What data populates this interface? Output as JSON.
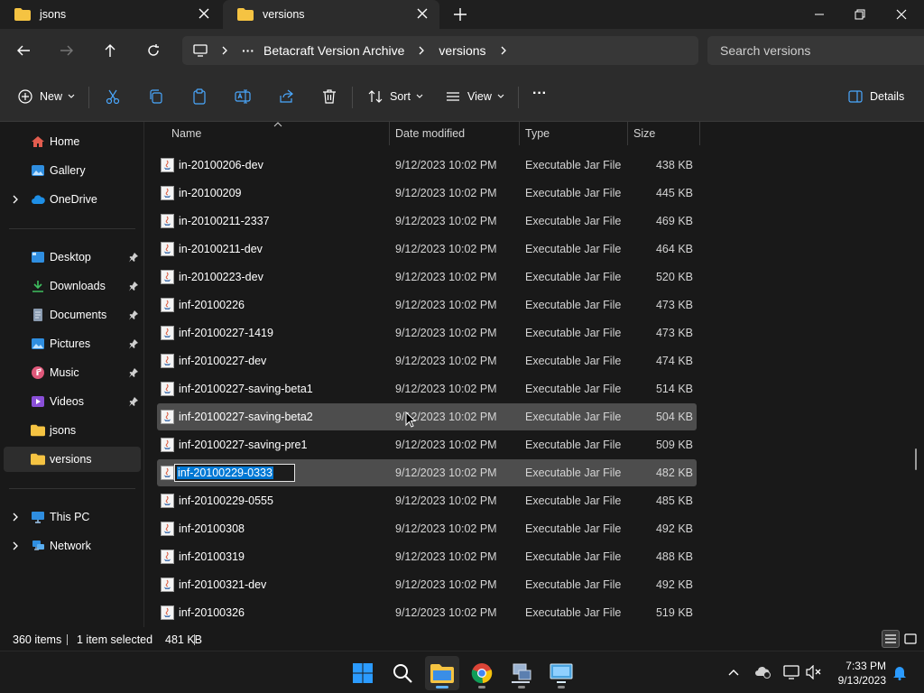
{
  "tabs": [
    {
      "label": "jsons",
      "active": false
    },
    {
      "label": "versions",
      "active": true
    }
  ],
  "breadcrumb": {
    "ellipsis": "···",
    "items": [
      "Betacraft Version Archive",
      "versions"
    ]
  },
  "search": {
    "placeholder": "Search versions"
  },
  "toolbar": {
    "new_label": "New",
    "sort_label": "Sort",
    "view_label": "View",
    "more_label": "···",
    "details_label": "Details"
  },
  "sidebar": {
    "top": [
      {
        "label": "Home",
        "icon": "home-icon"
      },
      {
        "label": "Gallery",
        "icon": "gallery-icon"
      },
      {
        "label": "OneDrive",
        "icon": "cloud-icon"
      }
    ],
    "pinned": [
      {
        "label": "Desktop",
        "icon": "desktop-icon"
      },
      {
        "label": "Downloads",
        "icon": "download-icon"
      },
      {
        "label": "Documents",
        "icon": "document-icon"
      },
      {
        "label": "Pictures",
        "icon": "pictures-icon"
      },
      {
        "label": "Music",
        "icon": "music-icon"
      },
      {
        "label": "Videos",
        "icon": "videos-icon"
      },
      {
        "label": "jsons",
        "icon": "folder-icon"
      },
      {
        "label": "versions",
        "icon": "folder-icon"
      }
    ],
    "bottom": [
      {
        "label": "This PC",
        "icon": "pc-icon"
      },
      {
        "label": "Network",
        "icon": "network-icon"
      }
    ]
  },
  "columns": {
    "name": "Name",
    "date": "Date modified",
    "type": "Type",
    "size": "Size"
  },
  "files": [
    {
      "name": "in-20100206-dev",
      "date": "9/12/2023 10:02 PM",
      "type": "Executable Jar File",
      "size": "438 KB"
    },
    {
      "name": "in-20100209",
      "date": "9/12/2023 10:02 PM",
      "type": "Executable Jar File",
      "size": "445 KB"
    },
    {
      "name": "in-20100211-2337",
      "date": "9/12/2023 10:02 PM",
      "type": "Executable Jar File",
      "size": "469 KB"
    },
    {
      "name": "in-20100211-dev",
      "date": "9/12/2023 10:02 PM",
      "type": "Executable Jar File",
      "size": "464 KB"
    },
    {
      "name": "in-20100223-dev",
      "date": "9/12/2023 10:02 PM",
      "type": "Executable Jar File",
      "size": "520 KB"
    },
    {
      "name": "inf-20100226",
      "date": "9/12/2023 10:02 PM",
      "type": "Executable Jar File",
      "size": "473 KB"
    },
    {
      "name": "inf-20100227-1419",
      "date": "9/12/2023 10:02 PM",
      "type": "Executable Jar File",
      "size": "473 KB"
    },
    {
      "name": "inf-20100227-dev",
      "date": "9/12/2023 10:02 PM",
      "type": "Executable Jar File",
      "size": "474 KB"
    },
    {
      "name": "inf-20100227-saving-beta1",
      "date": "9/12/2023 10:02 PM",
      "type": "Executable Jar File",
      "size": "514 KB"
    },
    {
      "name": "inf-20100227-saving-beta2",
      "date": "9/12/2023 10:02 PM",
      "type": "Executable Jar File",
      "size": "504 KB"
    },
    {
      "name": "inf-20100227-saving-pre1",
      "date": "9/12/2023 10:02 PM",
      "type": "Executable Jar File",
      "size": "509 KB"
    },
    {
      "name": "inf-20100229-0333",
      "date": "9/12/2023 10:02 PM",
      "type": "Executable Jar File",
      "size": "482 KB"
    },
    {
      "name": "inf-20100229-0555",
      "date": "9/12/2023 10:02 PM",
      "type": "Executable Jar File",
      "size": "485 KB"
    },
    {
      "name": "inf-20100308",
      "date": "9/12/2023 10:02 PM",
      "type": "Executable Jar File",
      "size": "492 KB"
    },
    {
      "name": "inf-20100319",
      "date": "9/12/2023 10:02 PM",
      "type": "Executable Jar File",
      "size": "488 KB"
    },
    {
      "name": "inf-20100321-dev",
      "date": "9/12/2023 10:02 PM",
      "type": "Executable Jar File",
      "size": "492 KB"
    },
    {
      "name": "inf-20100326",
      "date": "9/12/2023 10:02 PM",
      "type": "Executable Jar File",
      "size": "519 KB"
    }
  ],
  "status": {
    "item_count": "360 items",
    "selection": "1 item selected",
    "selection_size": "481 KB"
  },
  "clock": {
    "time": "7:33 PM",
    "date": "9/13/2023"
  },
  "colors": {
    "accent": "#0078d4",
    "folder": "#f5c342"
  }
}
